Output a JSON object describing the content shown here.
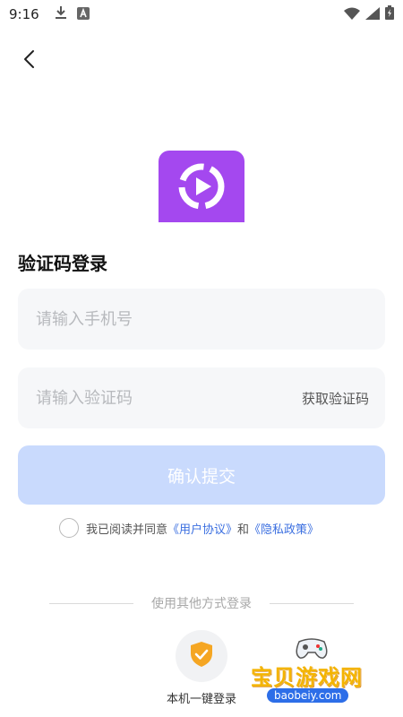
{
  "status_bar": {
    "time": "9:16"
  },
  "login": {
    "title": "验证码登录",
    "phone_placeholder": "请输入手机号",
    "code_placeholder": "请输入验证码",
    "get_code_label": "获取验证码",
    "submit_label": "确认提交"
  },
  "agreement": {
    "prefix": "我已阅读并同意",
    "user_agreement": "《用户协议》",
    "and": "和",
    "privacy_policy": "《隐私政策》"
  },
  "other_login": {
    "divider_text": "使用其他方式登录",
    "one_click_label": "本机一键登录"
  },
  "watermark": {
    "title": "宝贝游戏网",
    "url": "baobeiy.com"
  },
  "colors": {
    "logo_bg": "#a448ef",
    "submit_bg": "#c9dafd",
    "link": "#3b6fe0",
    "shield": "#f5a623"
  },
  "icons": [
    "download-icon",
    "a-badge-icon",
    "wifi-icon",
    "signal-icon",
    "battery-icon",
    "back-arrow-icon",
    "shield-check-icon"
  ]
}
